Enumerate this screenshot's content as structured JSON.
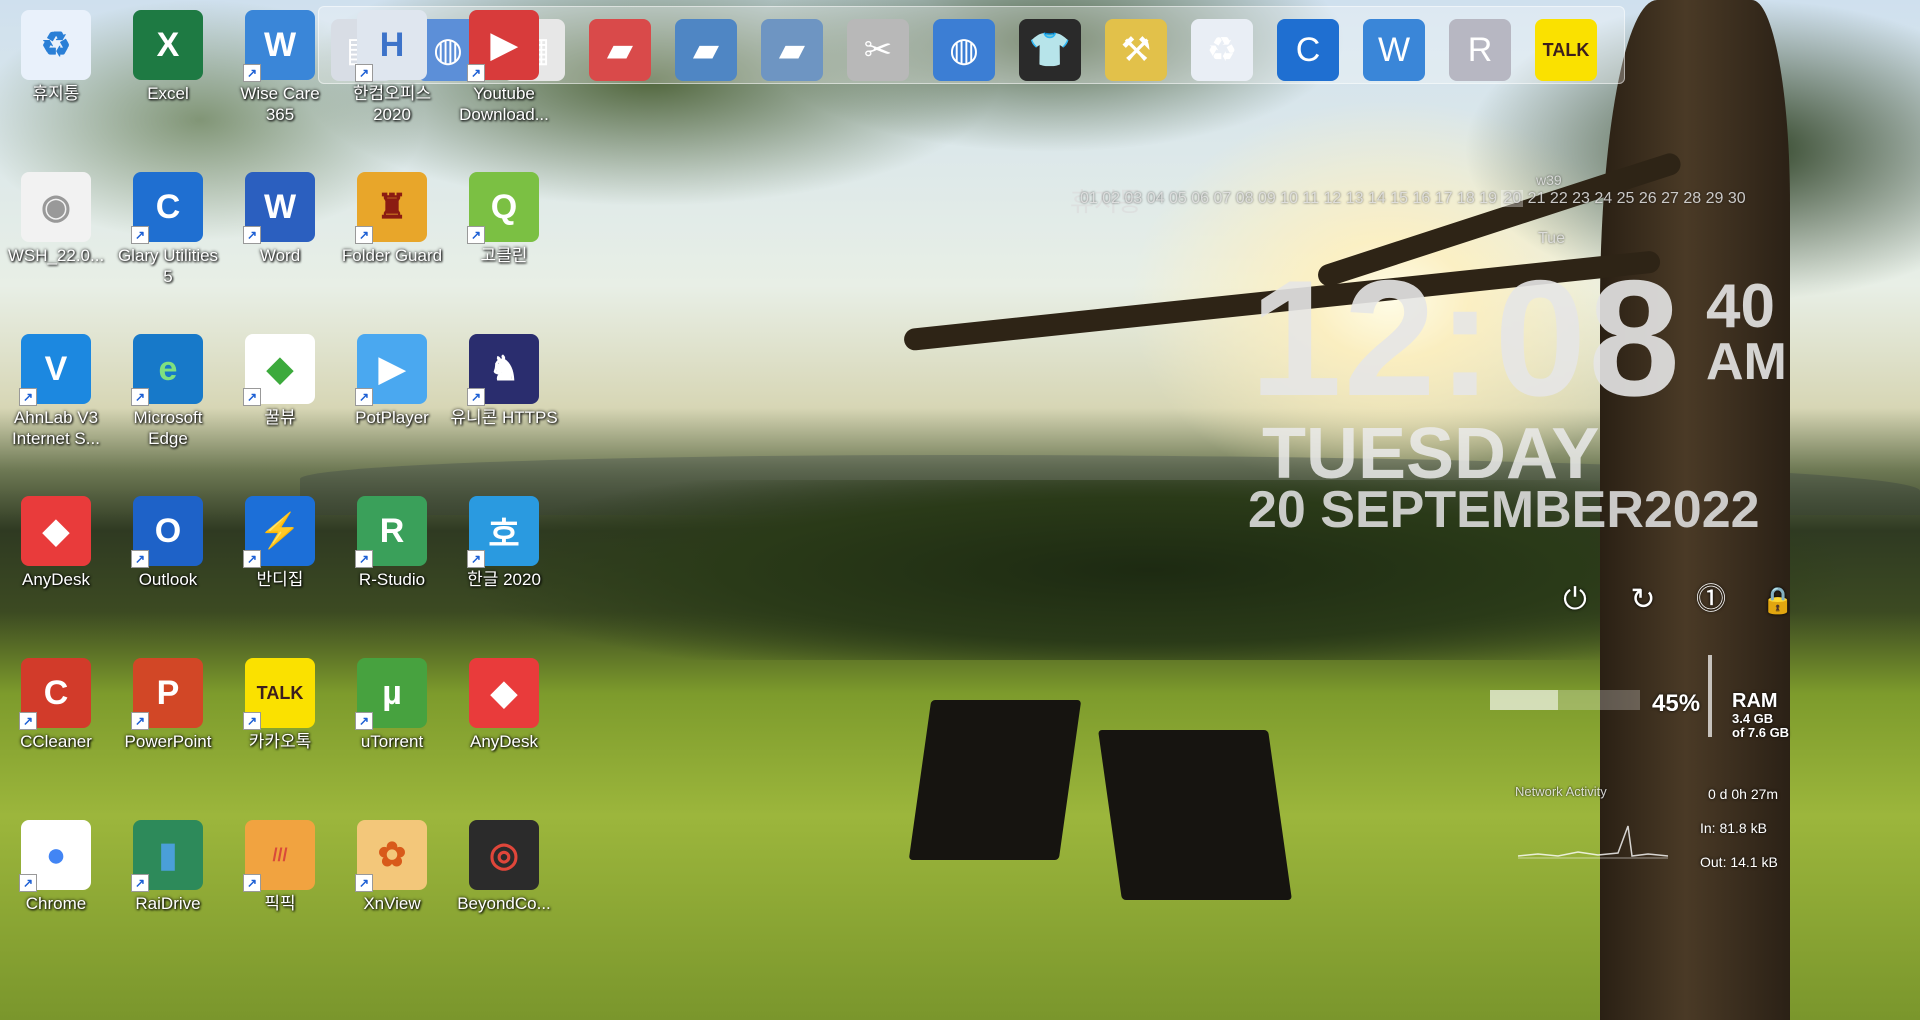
{
  "desktop": {
    "icons": [
      {
        "label": "휴지통",
        "glyph": "♻",
        "bg": "#e9f1fb",
        "color": "#2a7fd6",
        "shortcut": false
      },
      {
        "label": "Excel",
        "glyph": "X",
        "bg": "#1e7a43",
        "color": "#ffffff",
        "shortcut": false
      },
      {
        "label": "Wise Care 365",
        "glyph": "W",
        "bg": "#3a86d8",
        "color": "#ffffff",
        "shortcut": true
      },
      {
        "label": "한컴오피스 2020",
        "glyph": "H",
        "bg": "#dfe6ef",
        "color": "#3d73c9",
        "shortcut": true
      },
      {
        "label": "Youtube Download...",
        "glyph": "▶",
        "bg": "#d83b3b",
        "color": "#ffffff",
        "shortcut": true
      },
      {
        "label": "WSH_22.0...",
        "glyph": "◉",
        "bg": "#f2f2f2",
        "color": "#999999",
        "shortcut": false
      },
      {
        "label": "Glary Utilities 5",
        "glyph": "C",
        "bg": "#1f6fd1",
        "color": "#ffffff",
        "shortcut": true
      },
      {
        "label": "Word",
        "glyph": "W",
        "bg": "#2b5fbf",
        "color": "#ffffff",
        "shortcut": true
      },
      {
        "label": "Folder Guard",
        "glyph": "♜",
        "bg": "#e8a62a",
        "color": "#8b1c12",
        "shortcut": true
      },
      {
        "label": "고클린",
        "glyph": "Q",
        "bg": "#7bc043",
        "color": "#ffffff",
        "shortcut": true
      },
      {
        "label": "AhnLab V3 Internet S...",
        "glyph": "V",
        "bg": "#1c88e0",
        "color": "#ffffff",
        "shortcut": true
      },
      {
        "label": "Microsoft Edge",
        "glyph": "e",
        "bg": "#1779c9",
        "color": "#7fe07f",
        "shortcut": true
      },
      {
        "label": "꿀뷰",
        "glyph": "◆",
        "bg": "#ffffff",
        "color": "#3caa3c",
        "shortcut": true
      },
      {
        "label": "PotPlayer",
        "glyph": "▶",
        "bg": "#4aa8f0",
        "color": "#ffffff",
        "shortcut": true
      },
      {
        "label": "유니콘 HTTPS",
        "glyph": "♞",
        "bg": "#2a2d6e",
        "color": "#ffffff",
        "shortcut": true
      },
      {
        "label": "AnyDesk",
        "glyph": "◆",
        "bg": "#e93b3b",
        "color": "#ffffff",
        "shortcut": false
      },
      {
        "label": "Outlook",
        "glyph": "O",
        "bg": "#1e62c8",
        "color": "#ffffff",
        "shortcut": true
      },
      {
        "label": "반디집",
        "glyph": "⚡",
        "bg": "#1c6fd8",
        "color": "#ffffff",
        "shortcut": true
      },
      {
        "label": "R-Studio",
        "glyph": "R",
        "bg": "#3aa05a",
        "color": "#ffffff",
        "shortcut": true
      },
      {
        "label": "한글 2020",
        "glyph": "호",
        "bg": "#2a9ae0",
        "color": "#ffffff",
        "shortcut": true
      },
      {
        "label": "CCleaner",
        "glyph": "C",
        "bg": "#d23b2a",
        "color": "#ffffff",
        "shortcut": true
      },
      {
        "label": "PowerPoint",
        "glyph": "P",
        "bg": "#d24726",
        "color": "#ffffff",
        "shortcut": true
      },
      {
        "label": "카카오톡",
        "glyph": "TALK",
        "bg": "#fae100",
        "color": "#3b1e1e",
        "shortcut": true
      },
      {
        "label": "uTorrent",
        "glyph": "µ",
        "bg": "#47a23f",
        "color": "#ffffff",
        "shortcut": true
      },
      {
        "label": "AnyDesk",
        "glyph": "◆",
        "bg": "#e93b3b",
        "color": "#ffffff",
        "shortcut": false
      },
      {
        "label": "Chrome",
        "glyph": "●",
        "bg": "#ffffff",
        "color": "#4285f4",
        "shortcut": true
      },
      {
        "label": "RaiDrive",
        "glyph": "▮",
        "bg": "#2d8a5a",
        "color": "#4a9fd8",
        "shortcut": true
      },
      {
        "label": "픽픽",
        "glyph": "///",
        "bg": "#f1a340",
        "color": "#d94a3a",
        "shortcut": true
      },
      {
        "label": "XnView",
        "glyph": "✿",
        "bg": "#f3c77a",
        "color": "#d85a1a",
        "shortcut": true
      },
      {
        "label": "BeyondCo...",
        "glyph": "◎",
        "bg": "#2b2b2b",
        "color": "#e0463a",
        "shortcut": false
      }
    ]
  },
  "dock": {
    "items": [
      {
        "name": "dock-document-icon",
        "glyph": "▤",
        "bg": "#d8dde5"
      },
      {
        "name": "dock-globe-icon",
        "glyph": "◍",
        "bg": "#5c8fd8"
      },
      {
        "name": "dock-notes-icon",
        "glyph": "▦",
        "bg": "#e7e7e7"
      },
      {
        "name": "dock-red-folder-icon",
        "glyph": "▰",
        "bg": "#d94a4a"
      },
      {
        "name": "dock-folder-icon",
        "glyph": "▰",
        "bg": "#4f86c4"
      },
      {
        "name": "dock-folder-icon",
        "glyph": "▰",
        "bg": "#6e95c2"
      },
      {
        "name": "dock-tools-icon",
        "glyph": "✂",
        "bg": "#b8b8b8"
      },
      {
        "name": "dock-earth-icon",
        "glyph": "◍",
        "bg": "#3c7ed4"
      },
      {
        "name": "dock-shirt-icon",
        "glyph": "👕",
        "bg": "#2a2a2a"
      },
      {
        "name": "dock-hammer-icon",
        "glyph": "⚒",
        "bg": "#e2c14a"
      },
      {
        "name": "dock-recycle-bin-icon",
        "glyph": "♻",
        "bg": "#e9eef5"
      },
      {
        "name": "dock-glary-icon",
        "glyph": "C",
        "bg": "#1f6fd1"
      },
      {
        "name": "dock-wise-shield-icon",
        "glyph": "W",
        "bg": "#3a86d8"
      },
      {
        "name": "dock-rstudio-icon",
        "glyph": "R",
        "bg": "#b7b7c2"
      },
      {
        "name": "dock-kakaotalk-icon",
        "glyph": "TALK",
        "bg": "#fae100"
      }
    ]
  },
  "calendar": {
    "title": "휴지통",
    "week": "w39",
    "days": "01 02 03 04 05 06 07 08 09 10 11 12 13 14 15 16 17 18 19",
    "today": "20",
    "after": "21 22 23 24 25 26 27 28 29 30",
    "dow": "Tue"
  },
  "clock": {
    "time": "12:08",
    "seconds": "40",
    "ampm": "AM",
    "day": "TUESDAY",
    "date": "20 SEPTEMBER2022"
  },
  "system": {
    "power_glyph": "⏻",
    "restart_glyph": "↻",
    "logoff_glyph": "⓵",
    "lock_glyph": "🔒"
  },
  "ram": {
    "percent_text": "45%",
    "percent_value": 45,
    "label": "RAM",
    "used": "3.4 GB",
    "total": "of 7.6 GB"
  },
  "network": {
    "title": "Network Activity",
    "uptime": "0 d 0h 27m",
    "in": "In: 81.8 kB",
    "out": "Out: 14.1 kB"
  }
}
